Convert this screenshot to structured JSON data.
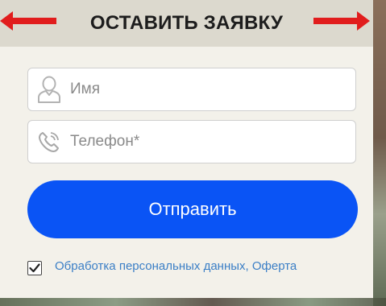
{
  "header": {
    "title": "ОСТАВИТЬ ЗАЯВКУ"
  },
  "form": {
    "name_placeholder": "Имя",
    "phone_placeholder": "Телефон*",
    "submit_label": "Отправить",
    "consent_checked": true,
    "consent_text": "Обработка персональных данных, Оферта"
  },
  "colors": {
    "header_bg": "#dcd9ce",
    "panel_bg": "#f3f1ea",
    "button": "#0a54f5",
    "link": "#3b7fc6",
    "arrows": "#e11d1d"
  },
  "icons": {
    "left_arrow": "arrow-left-icon",
    "right_arrow": "arrow-right-icon",
    "name_field": "user-icon",
    "phone_field": "phone-icon",
    "checkbox": "checkmark-icon"
  }
}
